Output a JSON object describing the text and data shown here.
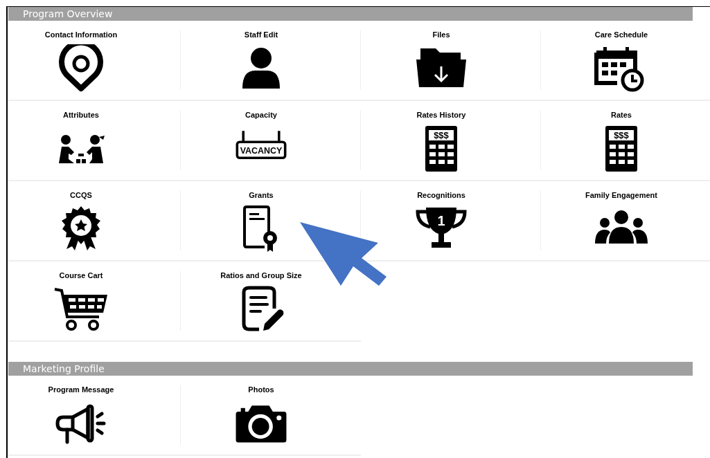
{
  "sections": [
    {
      "title": "Program Overview",
      "tiles": [
        {
          "label": "Contact Information"
        },
        {
          "label": "Staff Edit"
        },
        {
          "label": "Files"
        },
        {
          "label": "Care Schedule"
        },
        {
          "label": "Attributes"
        },
        {
          "label": "Capacity",
          "sign": "VACANCY"
        },
        {
          "label": "Rates History",
          "sign": "$$$"
        },
        {
          "label": "Rates",
          "sign": "$$$"
        },
        {
          "label": "CCQS"
        },
        {
          "label": "Grants"
        },
        {
          "label": "Recognitions",
          "sign": "1"
        },
        {
          "label": "Family Engagement"
        },
        {
          "label": "Course Cart"
        },
        {
          "label": "Ratios and Group Size"
        }
      ]
    },
    {
      "title": "Marketing Profile",
      "tiles": [
        {
          "label": "Program Message"
        },
        {
          "label": "Photos"
        }
      ]
    }
  ]
}
